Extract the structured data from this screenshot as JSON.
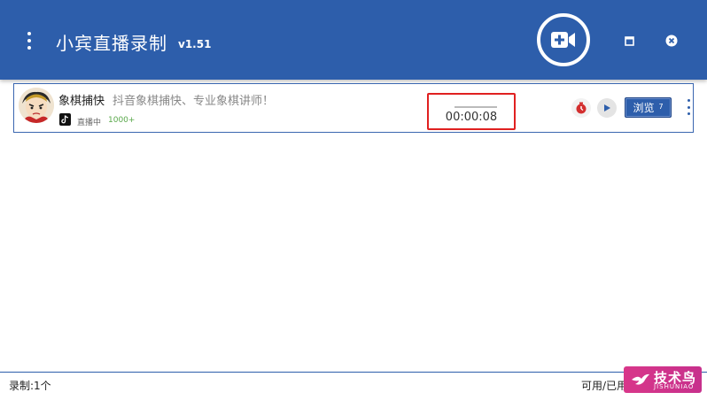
{
  "app": {
    "title": "小宾直播录制",
    "version": "v1.51",
    "menu_icon": "kebab-vertical-icon",
    "record_icon": "video-camera-add-icon",
    "maximize_icon": "maximize-icon",
    "close_icon": "close-circle-icon",
    "accent_color": "#2d5eab"
  },
  "recordings": [
    {
      "name": "象棋捕快",
      "description": "抖音象棋捕快、专业象棋讲师！",
      "platform_icon": "tiktok-icon",
      "status": "直播中",
      "viewers": "1000+",
      "elapsed": "00:00:08",
      "stop_icon": "stop-record-icon",
      "play_icon": "play-icon",
      "browse_label": "浏览",
      "browse_count": "7",
      "more_icon": "more-vertical-icon"
    }
  ],
  "status_bar": {
    "recording_count": "录制:1个",
    "disk_usage": "可用/已用"
  },
  "watermark": {
    "text": "技术鸟",
    "subtext": "JISHUNIAO"
  }
}
